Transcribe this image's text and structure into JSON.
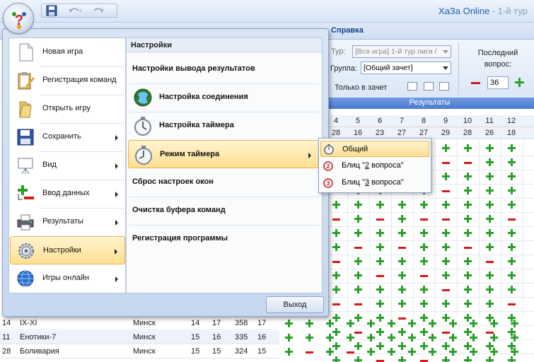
{
  "window": {
    "title_app": "ХаЗа Online",
    "title_doc": " - 1-й тур"
  },
  "ribbon": {
    "tab_help": "Справка",
    "tour_label": "Тур:",
    "tour_value": "[Вся игра] 1-й тур лиги /",
    "group_label": "Группа:",
    "group_value": "[Общий зачет]",
    "only_offset": "Только в зачет",
    "last_question_label": "Последний вопрос:",
    "last_question_value": "36",
    "results_header": "Результаты"
  },
  "grid": {
    "question_numbers": [
      "4",
      "5",
      "6",
      "7",
      "8",
      "9",
      "10",
      "11",
      "12"
    ],
    "counts": [
      "28",
      "16",
      "23",
      "27",
      "27",
      "29",
      "28",
      "26",
      "18"
    ],
    "rows": [
      [
        "+",
        "+",
        "+",
        "+",
        "+",
        "+",
        "+",
        "+",
        "+"
      ],
      [
        "+",
        "+",
        "+",
        "+",
        "-",
        "-",
        "-",
        "+",
        "+"
      ],
      [
        "+",
        "+",
        "-",
        "+",
        "+",
        "+",
        "+",
        "+",
        "+"
      ],
      [
        "-",
        "+",
        "+",
        "-",
        "+",
        "-",
        "+",
        "+",
        "+"
      ],
      [
        "+",
        "+",
        "+",
        "+",
        "+",
        "+",
        "+",
        "+",
        "+"
      ],
      [
        "-",
        "+",
        "-",
        "+",
        "-",
        "-",
        "+",
        "+",
        "-"
      ],
      [
        "+",
        "+",
        "+",
        "+",
        "+",
        "+",
        "+",
        "+",
        "+"
      ],
      [
        "+",
        "-",
        "+",
        "-",
        "+",
        "+",
        "-",
        "+",
        "+"
      ],
      [
        "-",
        "+",
        "+",
        "+",
        "+",
        "+",
        "+",
        "-",
        "+"
      ],
      [
        "+",
        "+",
        "-",
        "+",
        "-",
        "+",
        "+",
        "+",
        "+"
      ],
      [
        "+",
        "+",
        "+",
        "+",
        "+",
        "-",
        "+",
        "+",
        "+"
      ],
      [
        "-",
        "-",
        "+",
        "+",
        "+",
        "+",
        "+",
        "+",
        "-"
      ],
      [
        "+",
        "+",
        "+",
        "-",
        "+",
        "+",
        "+",
        "+",
        "+"
      ],
      [
        "+",
        "-",
        "+",
        "+",
        "+",
        "-",
        "+",
        "-",
        "+"
      ],
      [
        "+",
        "+",
        "+",
        "+",
        "+",
        "+",
        "+",
        "+",
        "+"
      ],
      [
        "+",
        "+",
        "-",
        "+",
        "-",
        "+",
        "+",
        "+",
        "+"
      ]
    ]
  },
  "teams": [
    {
      "num": "14",
      "name": "IX-XI",
      "city": "Минск",
      "c1": "14",
      "c2": "17",
      "c3": "358",
      "c4": "17",
      "marks": [
        "+",
        "+",
        "+",
        "+",
        "+",
        "+",
        "+",
        "+",
        "+",
        "+",
        "+",
        "+"
      ]
    },
    {
      "num": "11",
      "name": "Енотики-7",
      "city": "Минск",
      "c1": "15",
      "c2": "16",
      "c3": "335",
      "c4": "16",
      "marks": [
        "+",
        "+",
        "+",
        "+",
        "+",
        "+",
        "+",
        "+",
        "+",
        "+",
        "+",
        "+"
      ]
    },
    {
      "num": "28",
      "name": "Боливария",
      "city": "Минск",
      "c1": "15",
      "c2": "15",
      "c3": "324",
      "c4": "15",
      "marks": [
        "+",
        "-",
        "+",
        "-",
        "+",
        "+",
        "+",
        "+",
        "+",
        "+",
        "+",
        "+"
      ]
    }
  ],
  "app_menu": {
    "items": [
      {
        "label": "Новая игра",
        "icon": "new-document-icon",
        "arrow": false
      },
      {
        "label": "Регистрация команд",
        "icon": "clipboard-edit-icon",
        "arrow": false
      },
      {
        "label": "Открыть игру",
        "icon": "open-folder-icon",
        "arrow": false
      },
      {
        "label": "Сохранить",
        "icon": "floppy-disk-icon",
        "arrow": true
      },
      {
        "label": "Вид",
        "icon": "presentation-board-icon",
        "arrow": true
      },
      {
        "label": "Ввод данных",
        "icon": "plus-minus-icon",
        "arrow": true
      },
      {
        "label": "Результаты",
        "icon": "printer-icon",
        "arrow": true
      },
      {
        "label": "Настройки",
        "icon": "gear-icon",
        "arrow": true
      },
      {
        "label": "Игры онлайн",
        "icon": "globe-icon",
        "arrow": true
      }
    ],
    "settings_title": "Настройки",
    "settings_items": [
      {
        "label": "Настройки вывода результатов"
      },
      {
        "label": "Настройка соединения"
      },
      {
        "label": "Настройка таймера"
      },
      {
        "label": "Режим таймера"
      },
      {
        "label": "Сброс настроек окон"
      },
      {
        "label": "Очистка буфера команд"
      },
      {
        "label": "Регистрация программы"
      }
    ],
    "exit_label": "Выход"
  },
  "timer_submenu": {
    "items": [
      {
        "label": "Общий"
      },
      {
        "label_pre": "Блиц \"",
        "label_key": "2",
        "label_post": " вопроса\""
      },
      {
        "label_pre": "Блиц \"",
        "label_key": "3",
        "label_post": " вопроса\""
      }
    ]
  },
  "colors": {
    "plus": "#2a9f2a",
    "minus": "#d41a1a",
    "selection": "#ffdf92",
    "title_text": "#1e5fb3"
  }
}
